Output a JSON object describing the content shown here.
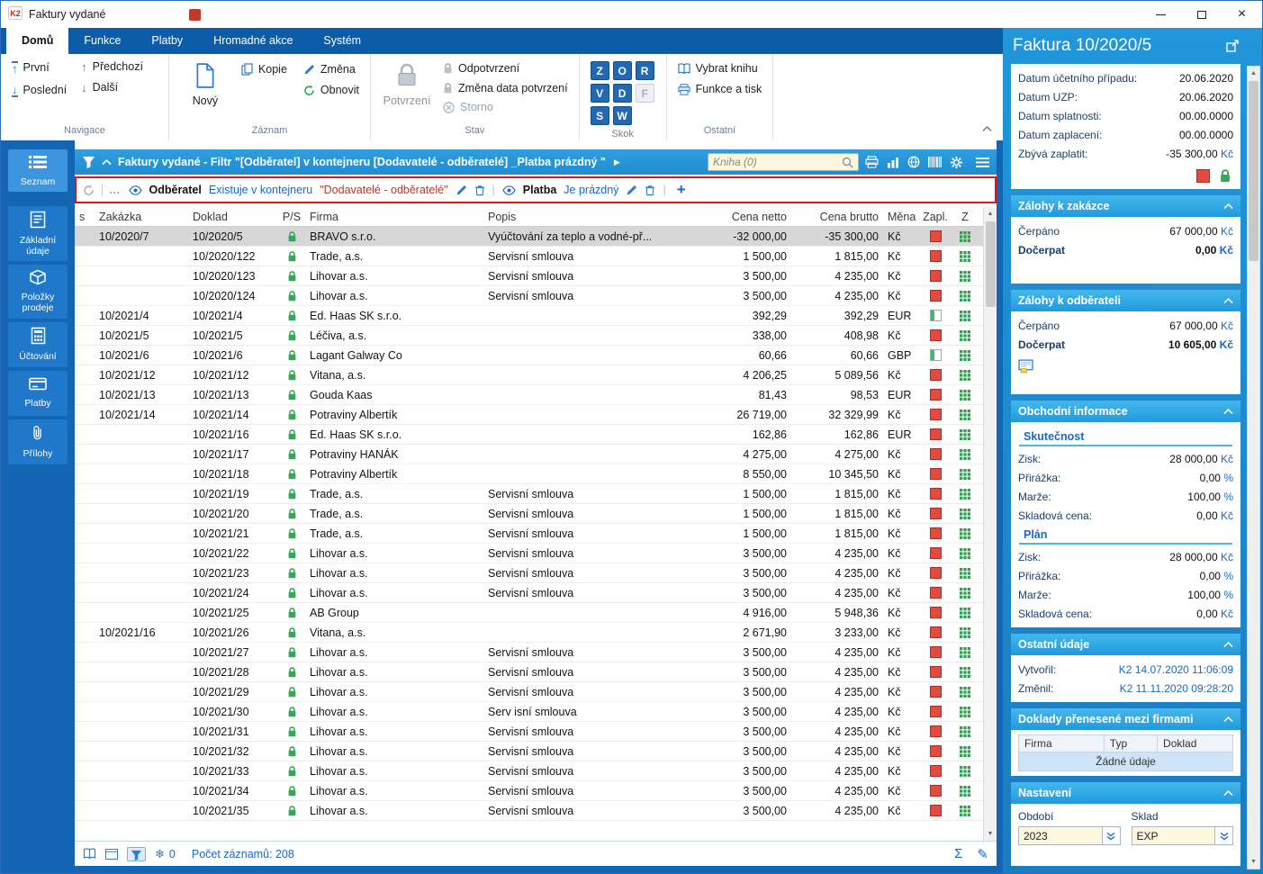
{
  "titlebar": {
    "title": "Faktury vydané"
  },
  "tabbar": {
    "tabs": [
      {
        "label": "Domů",
        "active": true
      },
      {
        "label": "Funkce",
        "active": false
      },
      {
        "label": "Platby",
        "active": false
      },
      {
        "label": "Hromadné akce",
        "active": false
      },
      {
        "label": "Systém",
        "active": false
      }
    ]
  },
  "ribbon": {
    "navigace": {
      "title": "Navigace",
      "prvni": "První",
      "posledni": "Poslední",
      "predchozi": "Předchozí",
      "dalsi": "Další"
    },
    "zaznam": {
      "title": "Záznam",
      "novy": "Nový",
      "kopie": "Kopie",
      "zmena": "Změna",
      "obnovit": "Obnovit"
    },
    "stav": {
      "title": "Stav",
      "potvrzeni": "Potvrzení",
      "odpotvrzeni": "Odpotvrzení",
      "zmena_data": "Změna data potvrzení",
      "storno": "Storno"
    },
    "skok": {
      "title": "Skok",
      "keys": [
        {
          "label": "Z",
          "enabled": true
        },
        {
          "label": "O",
          "enabled": true
        },
        {
          "label": "R",
          "enabled": true
        },
        {
          "label": "V",
          "enabled": true
        },
        {
          "label": "D",
          "enabled": true
        },
        {
          "label": "F",
          "enabled": false
        },
        {
          "label": "S",
          "enabled": true
        },
        {
          "label": "W",
          "enabled": true
        }
      ]
    },
    "ostatni": {
      "title": "Ostatní",
      "vybrat_knihu": "Vybrat knihu",
      "funkce_a_tisk": "Funkce a tisk"
    }
  },
  "sidebar": {
    "items": [
      {
        "label": "Seznam",
        "icon": "list-icon",
        "active": true
      },
      {
        "label": "Základní údaje",
        "icon": "details-icon",
        "active": false
      },
      {
        "label": "Položky prodeje",
        "icon": "items-icon",
        "active": false
      },
      {
        "label": "Účtování",
        "icon": "accounting-icon",
        "active": false
      },
      {
        "label": "Platby",
        "icon": "payments-icon",
        "active": false
      },
      {
        "label": "Přílohy",
        "icon": "attachments-icon",
        "active": false
      }
    ]
  },
  "filterbar": {
    "title": "Faktury vydané - Filtr \"[Odběratel] v kontejneru [Dodavatelé - odběratelé] _Platba prázdný \"",
    "search_placeholder": "Kniha (0)"
  },
  "filter_conditions": {
    "cond1_field": "Odběratel",
    "cond1_op": "Existuje v kontejneru",
    "cond1_value": "\"Dodavatelé - odběratelé\"",
    "cond2_field": "Platba",
    "cond2_op": "Je prázdný"
  },
  "table": {
    "columns": [
      "s",
      "Zakázka",
      "Doklad",
      "P/S",
      "Firma",
      "Popis",
      "Cena netto",
      "Cena brutto",
      "Měna",
      "Zapl.",
      "Z"
    ],
    "rows": [
      {
        "zakazka": "10/2020/7",
        "doklad": "10/2020/5",
        "firma": "BRAVO s.r.o.",
        "popis": "Vyúčtování za teplo a vodné-př...",
        "netto": "-32 000,00",
        "brutto": "-35 300,00",
        "mena": "Kč",
        "zapl": "red",
        "selected": true
      },
      {
        "zakazka": "",
        "doklad": "10/2020/122",
        "firma": "Trade, a.s.",
        "popis": "Servisní smlouva",
        "netto": "1 500,00",
        "brutto": "1 815,00",
        "mena": "Kč",
        "zapl": "red",
        "selected": false
      },
      {
        "zakazka": "",
        "doklad": "10/2020/123",
        "firma": "Lihovar a.s.",
        "popis": "Servisní smlouva",
        "netto": "3 500,00",
        "brutto": "4 235,00",
        "mena": "Kč",
        "zapl": "red",
        "selected": false
      },
      {
        "zakazka": "",
        "doklad": "10/2020/124",
        "firma": "Lihovar a.s.",
        "popis": "Servisní smlouva",
        "netto": "3 500,00",
        "brutto": "4 235,00",
        "mena": "Kč",
        "zapl": "red",
        "selected": false
      },
      {
        "zakazka": "10/2021/4",
        "doklad": "10/2021/4",
        "firma": "Ed. Haas SK s.r.o.",
        "popis": "",
        "netto": "392,29",
        "brutto": "392,29",
        "mena": "EUR",
        "zapl": "partial",
        "selected": false
      },
      {
        "zakazka": "10/2021/5",
        "doklad": "10/2021/5",
        "firma": "Léčiva, a.s.",
        "popis": "",
        "netto": "338,00",
        "brutto": "408,98",
        "mena": "Kč",
        "zapl": "red",
        "selected": false
      },
      {
        "zakazka": "10/2021/6",
        "doklad": "10/2021/6",
        "firma": "Lagant Galway Co",
        "popis": "",
        "netto": "60,66",
        "brutto": "60,66",
        "mena": "GBP",
        "zapl": "partial",
        "selected": false
      },
      {
        "zakazka": "10/2021/12",
        "doklad": "10/2021/12",
        "firma": "Vitana, a.s.",
        "popis": "",
        "netto": "4 206,25",
        "brutto": "5 089,56",
        "mena": "Kč",
        "zapl": "red",
        "selected": false
      },
      {
        "zakazka": "10/2021/13",
        "doklad": "10/2021/13",
        "firma": "Gouda Kaas",
        "popis": "",
        "netto": "81,43",
        "brutto": "98,53",
        "mena": "EUR",
        "zapl": "red",
        "selected": false
      },
      {
        "zakazka": "10/2021/14",
        "doklad": "10/2021/14",
        "firma": "Potraviny Albertík",
        "popis": "",
        "netto": "26 719,00",
        "brutto": "32 329,99",
        "mena": "Kč",
        "zapl": "red",
        "selected": false
      },
      {
        "zakazka": "",
        "doklad": "10/2021/16",
        "firma": "Ed. Haas SK s.r.o.",
        "popis": "",
        "netto": "162,86",
        "brutto": "162,86",
        "mena": "EUR",
        "zapl": "red",
        "selected": false
      },
      {
        "zakazka": "",
        "doklad": "10/2021/17",
        "firma": "Potraviny HANÁK",
        "popis": "",
        "netto": "4 275,00",
        "brutto": "4 275,00",
        "mena": "Kč",
        "zapl": "red",
        "selected": false
      },
      {
        "zakazka": "",
        "doklad": "10/2021/18",
        "firma": "Potraviny Albertík",
        "popis": "",
        "netto": "8 550,00",
        "brutto": "10 345,50",
        "mena": "Kč",
        "zapl": "red",
        "selected": false
      },
      {
        "zakazka": "",
        "doklad": "10/2021/19",
        "firma": "Trade, a.s.",
        "popis": "Servisní smlouva",
        "netto": "1 500,00",
        "brutto": "1 815,00",
        "mena": "Kč",
        "zapl": "red",
        "selected": false
      },
      {
        "zakazka": "",
        "doklad": "10/2021/20",
        "firma": "Trade, a.s.",
        "popis": "Servisní smlouva",
        "netto": "1 500,00",
        "brutto": "1 815,00",
        "mena": "Kč",
        "zapl": "red",
        "selected": false
      },
      {
        "zakazka": "",
        "doklad": "10/2021/21",
        "firma": "Trade, a.s.",
        "popis": "Servisní smlouva",
        "netto": "1 500,00",
        "brutto": "1 815,00",
        "mena": "Kč",
        "zapl": "red",
        "selected": false
      },
      {
        "zakazka": "",
        "doklad": "10/2021/22",
        "firma": "Lihovar a.s.",
        "popis": "Servisní smlouva",
        "netto": "3 500,00",
        "brutto": "4 235,00",
        "mena": "Kč",
        "zapl": "red",
        "selected": false
      },
      {
        "zakazka": "",
        "doklad": "10/2021/23",
        "firma": "Lihovar a.s.",
        "popis": "Servisní smlouva",
        "netto": "3 500,00",
        "brutto": "4 235,00",
        "mena": "Kč",
        "zapl": "red",
        "selected": false
      },
      {
        "zakazka": "",
        "doklad": "10/2021/24",
        "firma": "Lihovar a.s.",
        "popis": "Servisní smlouva",
        "netto": "3 500,00",
        "brutto": "4 235,00",
        "mena": "Kč",
        "zapl": "red",
        "selected": false
      },
      {
        "zakazka": "",
        "doklad": "10/2021/25",
        "firma": "AB Group",
        "popis": "",
        "netto": "4 916,00",
        "brutto": "5 948,36",
        "mena": "Kč",
        "zapl": "red",
        "selected": false
      },
      {
        "zakazka": "10/2021/16",
        "doklad": "10/2021/26",
        "firma": "Vitana, a.s.",
        "popis": "",
        "netto": "2 671,90",
        "brutto": "3 233,00",
        "mena": "Kč",
        "zapl": "red",
        "selected": false
      },
      {
        "zakazka": "",
        "doklad": "10/2021/27",
        "firma": "Lihovar a.s.",
        "popis": "Servisní smlouva",
        "netto": "3 500,00",
        "brutto": "4 235,00",
        "mena": "Kč",
        "zapl": "red",
        "selected": false
      },
      {
        "zakazka": "",
        "doklad": "10/2021/28",
        "firma": "Lihovar a.s.",
        "popis": "Servisní smlouva",
        "netto": "3 500,00",
        "brutto": "4 235,00",
        "mena": "Kč",
        "zapl": "red",
        "selected": false
      },
      {
        "zakazka": "",
        "doklad": "10/2021/29",
        "firma": "Lihovar a.s.",
        "popis": "Servisní smlouva",
        "netto": "3 500,00",
        "brutto": "4 235,00",
        "mena": "Kč",
        "zapl": "red",
        "selected": false
      },
      {
        "zakazka": "",
        "doklad": "10/2021/30",
        "firma": "Lihovar a.s.",
        "popis": "Serv isní smlouva",
        "netto": "3 500,00",
        "brutto": "4 235,00",
        "mena": "Kč",
        "zapl": "red",
        "selected": false
      },
      {
        "zakazka": "",
        "doklad": "10/2021/31",
        "firma": "Lihovar a.s.",
        "popis": "Servisní smlouva",
        "netto": "3 500,00",
        "brutto": "4 235,00",
        "mena": "Kč",
        "zapl": "red",
        "selected": false
      },
      {
        "zakazka": "",
        "doklad": "10/2021/32",
        "firma": "Lihovar a.s.",
        "popis": "Servisní smlouva",
        "netto": "3 500,00",
        "brutto": "4 235,00",
        "mena": "Kč",
        "zapl": "red",
        "selected": false
      },
      {
        "zakazka": "",
        "doklad": "10/2021/33",
        "firma": "Lihovar a.s.",
        "popis": "Servisní smlouva",
        "netto": "3 500,00",
        "brutto": "4 235,00",
        "mena": "Kč",
        "zapl": "red",
        "selected": false
      },
      {
        "zakazka": "",
        "doklad": "10/2021/34",
        "firma": "Lihovar a.s.",
        "popis": "Servisní smlouva",
        "netto": "3 500,00",
        "brutto": "4 235,00",
        "mena": "Kč",
        "zapl": "red",
        "selected": false
      },
      {
        "zakazka": "",
        "doklad": "10/2021/35",
        "firma": "Lihovar a.s.",
        "popis": "Servisní smlouva",
        "netto": "3 500,00",
        "brutto": "4 235,00",
        "mena": "Kč",
        "zapl": "red",
        "selected": false
      }
    ]
  },
  "statusbar": {
    "snowflake_count": "0",
    "record_count": "Počet záznamů: 208"
  },
  "detail_panel": {
    "title": "Faktura 10/2020/5",
    "dates": [
      {
        "label": "Datum účetního případu:",
        "value": "20.06.2020"
      },
      {
        "label": "Datum UZP:",
        "value": "20.06.2020"
      },
      {
        "label": "Datum splatnosti:",
        "value": "00.00.0000"
      },
      {
        "label": "Datum zaplacení:",
        "value": "00.00.0000"
      },
      {
        "label": "Zbývá zaplatit:",
        "value": "-35 300,00",
        "unit": "Kč"
      }
    ],
    "zalohy_zakazka": {
      "title": "Zálohy k zakázce",
      "rows": [
        {
          "label": "Čerpáno",
          "value": "67 000,00",
          "unit": "Kč",
          "bold": false
        },
        {
          "label": "Dočerpat",
          "value": "0,00",
          "unit": "Kč",
          "bold": true
        }
      ]
    },
    "zalohy_odberatel": {
      "title": "Zálohy k odběrateli",
      "rows": [
        {
          "label": "Čerpáno",
          "value": "67 000,00",
          "unit": "Kč",
          "bold": false
        },
        {
          "label": "Dočerpat",
          "value": "10 605,00",
          "unit": "Kč",
          "bold": true
        }
      ]
    },
    "obchodni": {
      "title": "Obchodní informace",
      "sections": [
        {
          "name": "Skutečnost",
          "rows": [
            {
              "label": "Zisk:",
              "value": "28 000,00",
              "unit": "Kč"
            },
            {
              "label": "Přirážka:",
              "value": "0,00",
              "unit": "%"
            },
            {
              "label": "Marže:",
              "value": "100,00",
              "unit": "%"
            },
            {
              "label": "Skladová cena:",
              "value": "0,00",
              "unit": "Kč"
            }
          ]
        },
        {
          "name": "Plán",
          "rows": [
            {
              "label": "Zisk:",
              "value": "28 000,00",
              "unit": "Kč"
            },
            {
              "label": "Přirážka:",
              "value": "0,00",
              "unit": "%"
            },
            {
              "label": "Marže:",
              "value": "100,00",
              "unit": "%"
            },
            {
              "label": "Skladová cena:",
              "value": "0,00",
              "unit": "Kč"
            }
          ]
        }
      ]
    },
    "ostatni_udaje": {
      "title": "Ostatní údaje",
      "rows": [
        {
          "label": "Vytvořil:",
          "value": "K2 14.07.2020 11:06:09"
        },
        {
          "label": "Změnil:",
          "value": "K2 11.11.2020 09:28:20"
        }
      ]
    },
    "doklady": {
      "title": "Doklady přenesené mezi firmami",
      "columns": [
        "Firma",
        "Typ",
        "Doklad"
      ],
      "empty_text": "Žádné údaje"
    },
    "nastaveni": {
      "title": "Nastavení",
      "obdobi_label": "Období",
      "obdobi_value": "2023",
      "sklad_label": "Sklad",
      "sklad_value": "EXP"
    }
  },
  "icons": {
    "app_logo": "K2",
    "funnel": "filter-funnel",
    "search": "magnifier",
    "padlock": "green-lock",
    "grid": "green-table-grid",
    "snowflake": "❄",
    "sum": "Σ",
    "edit": "✎"
  }
}
